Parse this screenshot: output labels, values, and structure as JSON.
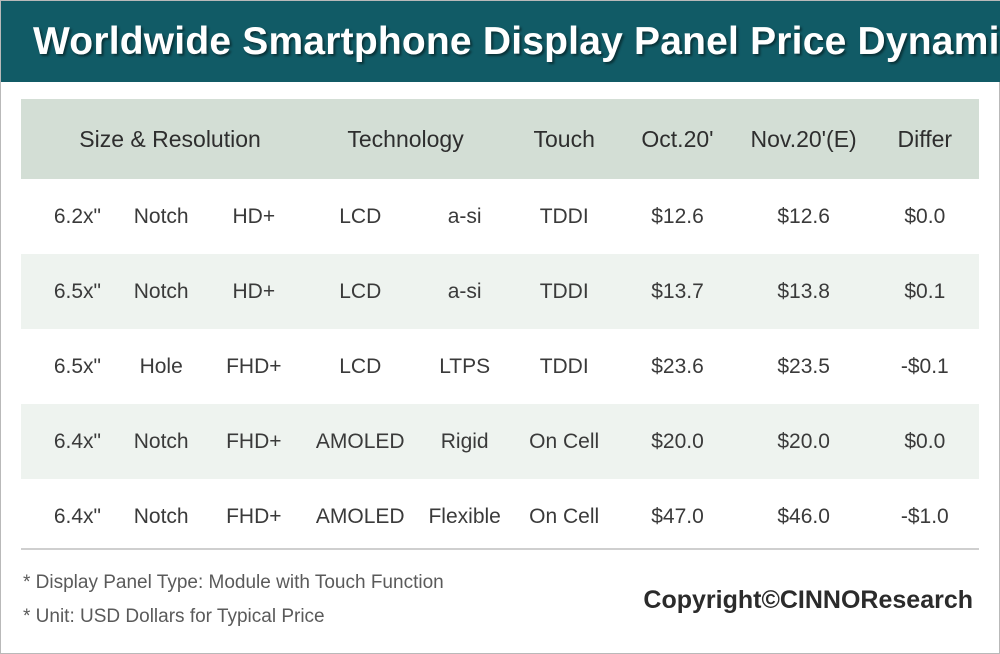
{
  "title": "Worldwide Smartphone Display Panel Price Dynamic",
  "theme": {
    "title_bar_color": "#115b66",
    "header_row_color": "#d3ded5",
    "alt_row_color": "#eef3ef",
    "row_color": "#ffffff",
    "text_color": "#3a3a3a",
    "border_color": "#b9b9b9"
  },
  "table": {
    "headers": {
      "size_resolution": "Size & Resolution",
      "technology": "Technology",
      "touch": "Touch",
      "oct": "Oct.20'",
      "nov": "Nov.20'(E)",
      "differ": "Differ"
    },
    "rows": [
      {
        "size": "6.2x\"",
        "cutout": "Notch",
        "resolution": "HD+",
        "panel": "LCD",
        "backplane": "a-si",
        "touch": "TDDI",
        "oct": "$12.6",
        "nov": "$12.6",
        "differ": "$0.0"
      },
      {
        "size": "6.5x\"",
        "cutout": "Notch",
        "resolution": "HD+",
        "panel": "LCD",
        "backplane": "a-si",
        "touch": "TDDI",
        "oct": "$13.7",
        "nov": "$13.8",
        "differ": "$0.1"
      },
      {
        "size": "6.5x\"",
        "cutout": "Hole",
        "resolution": "FHD+",
        "panel": "LCD",
        "backplane": "LTPS",
        "touch": "TDDI",
        "oct": "$23.6",
        "nov": "$23.5",
        "differ": "-$0.1"
      },
      {
        "size": "6.4x\"",
        "cutout": "Notch",
        "resolution": "FHD+",
        "panel": "AMOLED",
        "backplane": "Rigid",
        "touch": "On Cell",
        "oct": "$20.0",
        "nov": "$20.0",
        "differ": "$0.0"
      },
      {
        "size": "6.4x\"",
        "cutout": "Notch",
        "resolution": "FHD+",
        "panel": "AMOLED",
        "backplane": "Flexible",
        "touch": "On Cell",
        "oct": "$47.0",
        "nov": "$46.0",
        "differ": "-$1.0"
      }
    ]
  },
  "footer": {
    "note_1": "* Display Panel Type:  Module with Touch Function",
    "note_2": "* Unit:  USD Dollars for Typical Price",
    "copyright": "Copyright©CINNOResearch"
  }
}
